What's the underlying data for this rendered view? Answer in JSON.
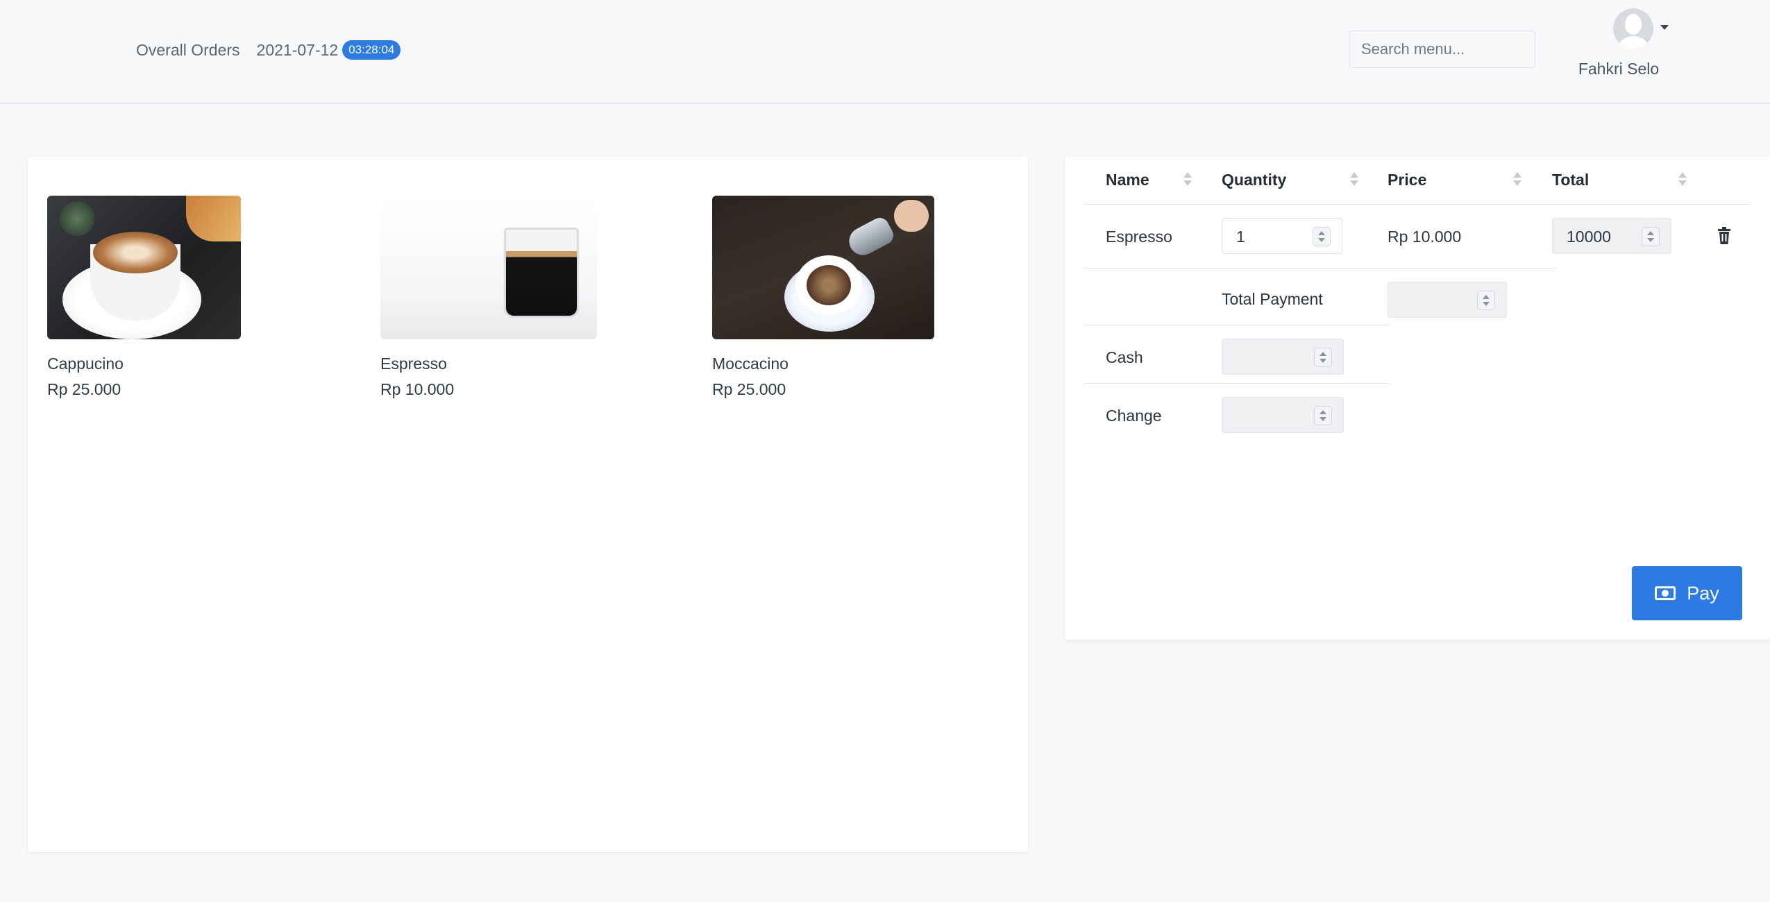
{
  "header": {
    "breadcrumb": "Overall Orders",
    "date": "2021-07-12",
    "time": "03:28:04",
    "search_placeholder": "Search menu...",
    "user_name": "Fahkri Selo"
  },
  "menu": [
    {
      "name": "Cappucino",
      "price": "Rp 25.000"
    },
    {
      "name": "Espresso",
      "price": "Rp 10.000"
    },
    {
      "name": "Moccacino",
      "price": "Rp 25.000"
    }
  ],
  "order": {
    "columns": [
      "Name",
      "Quantity",
      "Price",
      "Total"
    ],
    "rows": [
      {
        "name": "Espresso",
        "quantity": "1",
        "price": "Rp 10.000",
        "total": "10000"
      }
    ],
    "total_payment_label": "Total Payment",
    "total_payment_value": "",
    "cash_label": "Cash",
    "cash_value": "",
    "change_label": "Change",
    "change_value": "",
    "pay_label": "Pay"
  },
  "colors": {
    "accent": "#2c7be5",
    "background": "#f7f8fa"
  },
  "icons": {
    "user": "user-avatar-icon",
    "dropdown": "caret-down-icon",
    "sort": "sort-icon",
    "delete": "trash-icon",
    "pay": "money-bill-icon"
  }
}
